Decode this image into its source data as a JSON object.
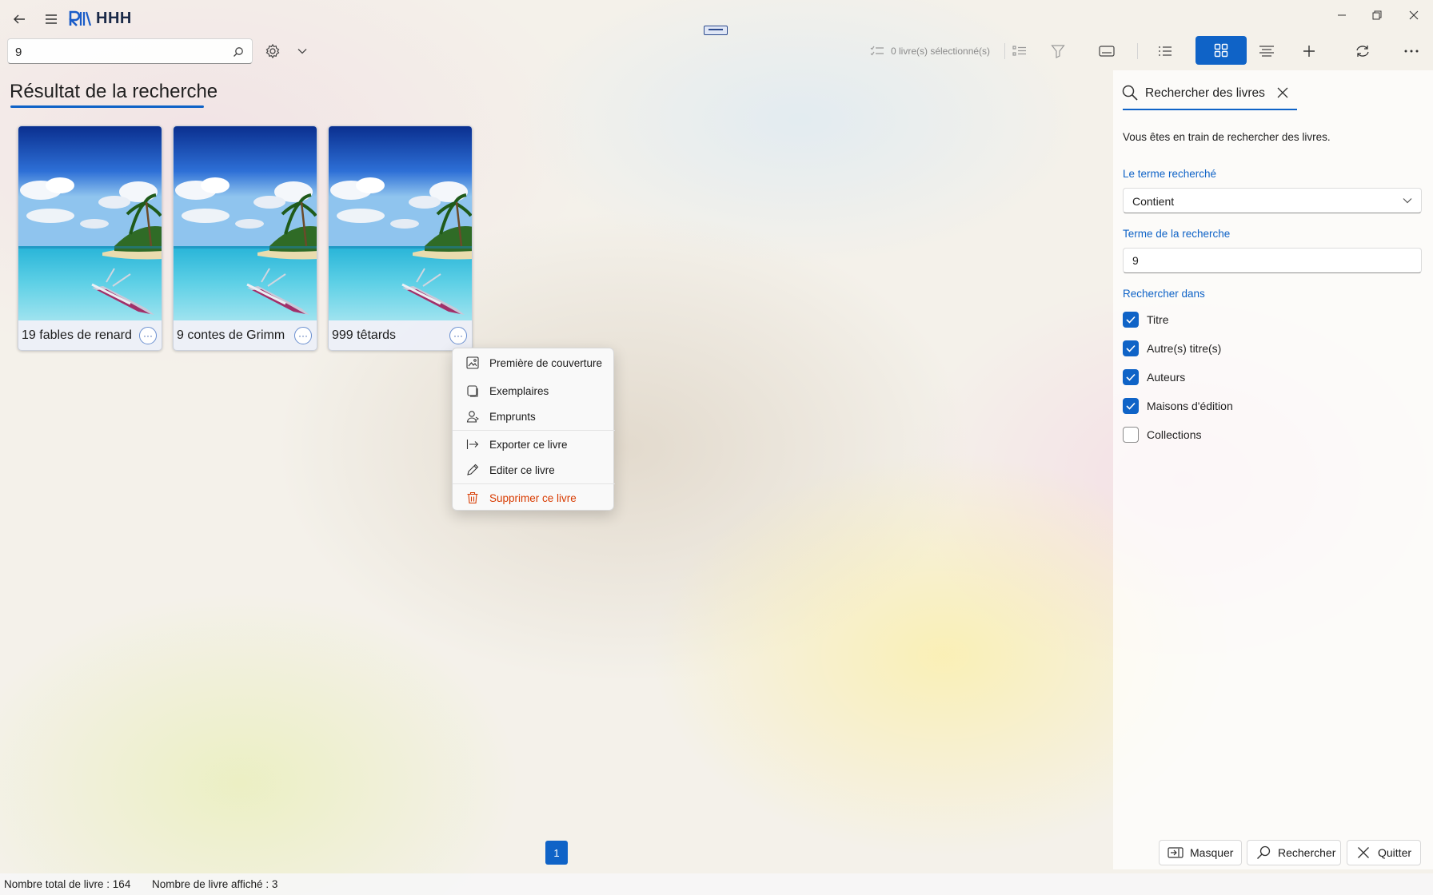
{
  "app": {
    "title": "HHH"
  },
  "toolbar": {
    "search_value": "9",
    "selection_count": "0 livre(s) sélectionné(s)"
  },
  "main": {
    "title": "Résultat de la recherche",
    "books": [
      {
        "title": "19 fables de renard"
      },
      {
        "title": "9 contes de Grimm"
      },
      {
        "title": "999 têtards"
      }
    ],
    "more_glyph": "···"
  },
  "context_menu": {
    "items": [
      {
        "label": "Première de couverture",
        "icon": "image-icon"
      },
      {
        "label": "Exemplaires",
        "icon": "copies-icon"
      },
      {
        "label": "Emprunts",
        "icon": "person-icon"
      },
      {
        "label": "Exporter ce livre",
        "icon": "export-icon"
      },
      {
        "label": "Editer ce livre",
        "icon": "pencil-icon"
      },
      {
        "label": "Supprimer ce livre",
        "icon": "trash-icon"
      }
    ]
  },
  "panel": {
    "title": "Rechercher des livres",
    "description": "Vous êtes en train de rechercher des livres.",
    "term_label": "Le terme recherché",
    "match_mode": "Contient",
    "search_term_label": "Terme de la recherche",
    "search_term_value": "9",
    "search_in_label": "Rechercher dans",
    "fields": [
      {
        "label": "Titre",
        "checked": true
      },
      {
        "label": "Autre(s) titre(s)",
        "checked": true
      },
      {
        "label": "Auteurs",
        "checked": true
      },
      {
        "label": "Maisons d'édition",
        "checked": true
      },
      {
        "label": "Collections",
        "checked": false
      }
    ],
    "buttons": {
      "hide": "Masquer",
      "search": "Rechercher",
      "quit": "Quitter"
    }
  },
  "pagination": {
    "current_page": "1"
  },
  "status": {
    "total": "Nombre total de livre : 164",
    "shown": "Nombre de livre affiché : 3"
  },
  "colors": {
    "accent": "#0f63c7",
    "danger": "#d83b01"
  }
}
